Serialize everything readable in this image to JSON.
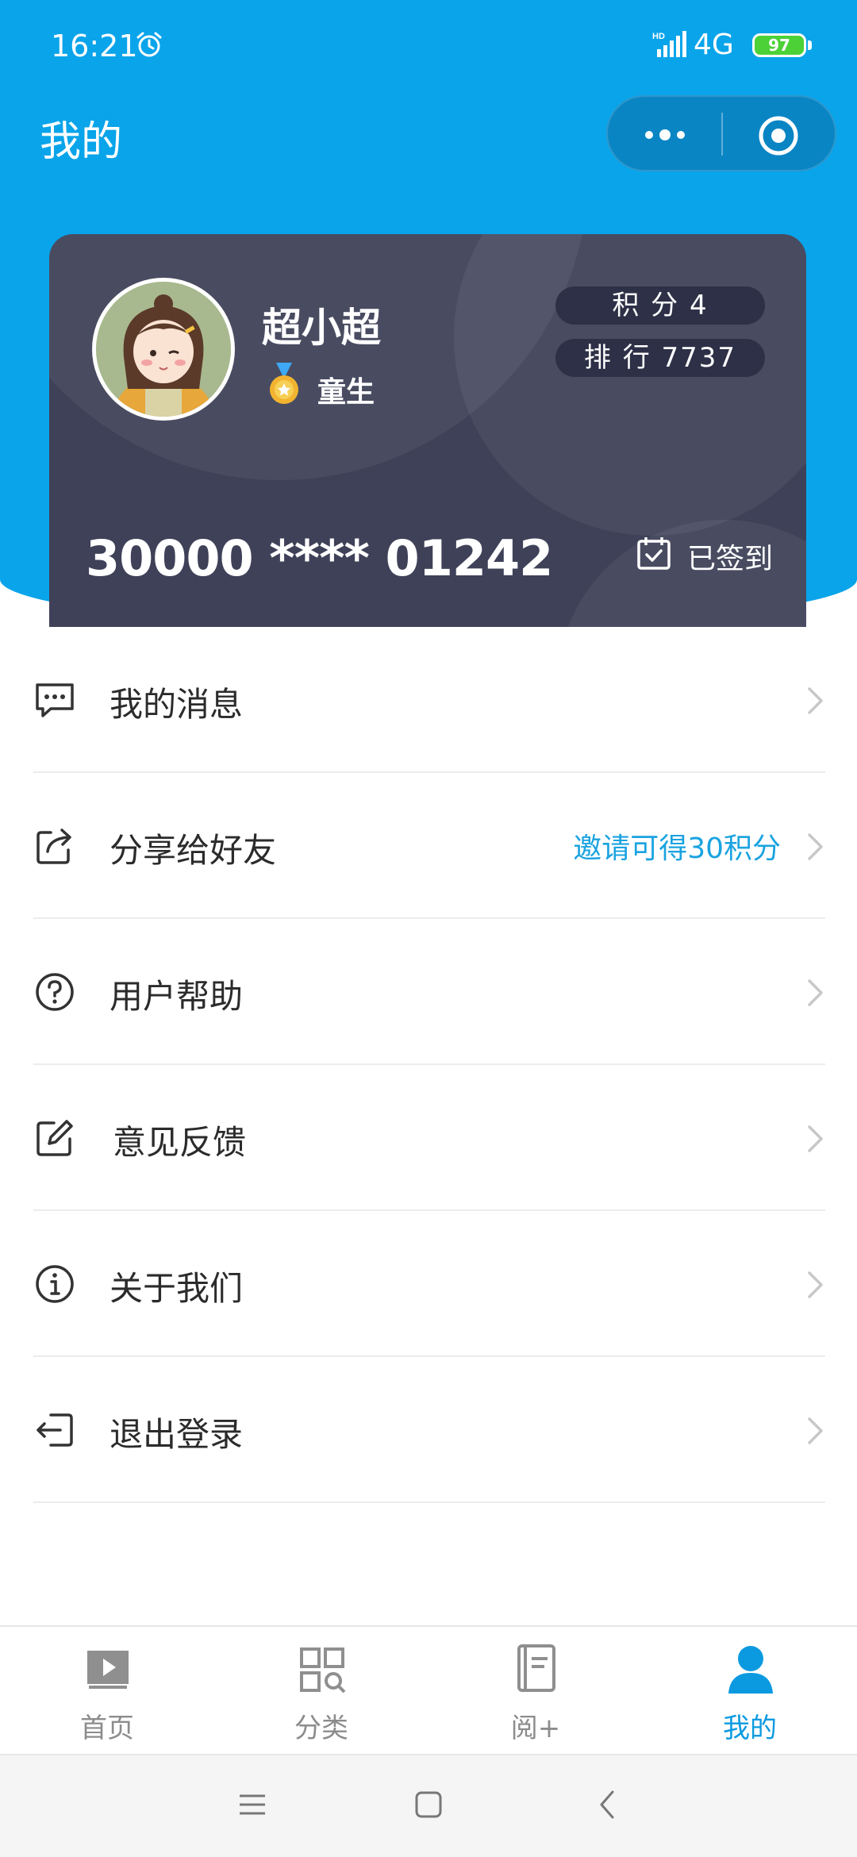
{
  "status_bar": {
    "time": "16:21",
    "network": "4G",
    "battery": "97"
  },
  "header": {
    "title": "我的"
  },
  "card": {
    "user_name": "超小超",
    "level": "童生",
    "points": "积 分 4",
    "rank": "排 行 7737",
    "number": "30000 **** 01242",
    "signin_status": "已签到"
  },
  "menu": {
    "items": [
      {
        "label": "我的消息",
        "icon": "message-icon"
      },
      {
        "label": "分享给好友",
        "extra": "邀请可得30积分",
        "icon": "share-icon"
      },
      {
        "label": "用户帮助",
        "icon": "help-icon"
      },
      {
        "label": "意见反馈",
        "icon": "feedback-icon"
      },
      {
        "label": "关于我们",
        "icon": "info-icon"
      },
      {
        "label": "退出登录",
        "icon": "logout-icon"
      }
    ]
  },
  "tabbar": {
    "tabs": [
      {
        "label": "首页",
        "icon": "play-book-icon"
      },
      {
        "label": "分类",
        "icon": "category-grid-icon"
      },
      {
        "label": "阅+",
        "icon": "document-icon"
      },
      {
        "label": "我的",
        "icon": "user-icon",
        "active": true
      }
    ]
  },
  "colors": {
    "primary": "#0aa4ea",
    "card": "#3e4158",
    "accent_text": "#1aa3e0",
    "active_tab": "#0b9ae0"
  }
}
